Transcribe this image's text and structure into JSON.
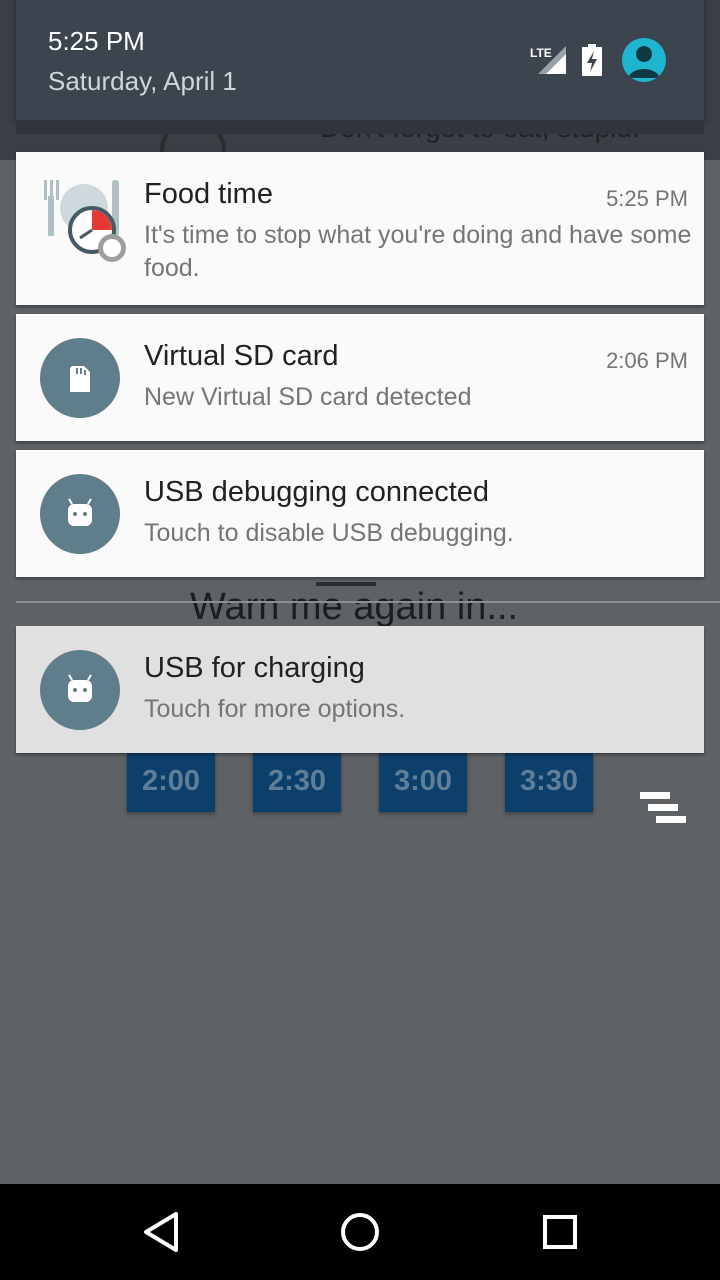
{
  "status": {
    "time": "5:25 PM",
    "date": "Saturday, April 1",
    "network": "LTE"
  },
  "background": {
    "reminder_text": "Don't forget to eat, stupid!",
    "warn_text": "Warn me again in...",
    "time_buttons": [
      "2:00",
      "2:30",
      "3:00",
      "3:30"
    ]
  },
  "notifications": [
    {
      "title": "Food time",
      "time": "5:25 PM",
      "body": "It's time to stop what you're doing and have some food."
    },
    {
      "title": "Virtual SD card",
      "time": "2:06 PM",
      "body": "New Virtual SD card detected"
    },
    {
      "title": "USB debugging connected",
      "body": "Touch to disable USB debugging."
    },
    {
      "title": "USB for charging",
      "body": "Touch for more options."
    }
  ],
  "colors": {
    "icon_circle": "#607d8b",
    "avatar": "#1fb5ce",
    "time_button": "#0d3f6b"
  }
}
